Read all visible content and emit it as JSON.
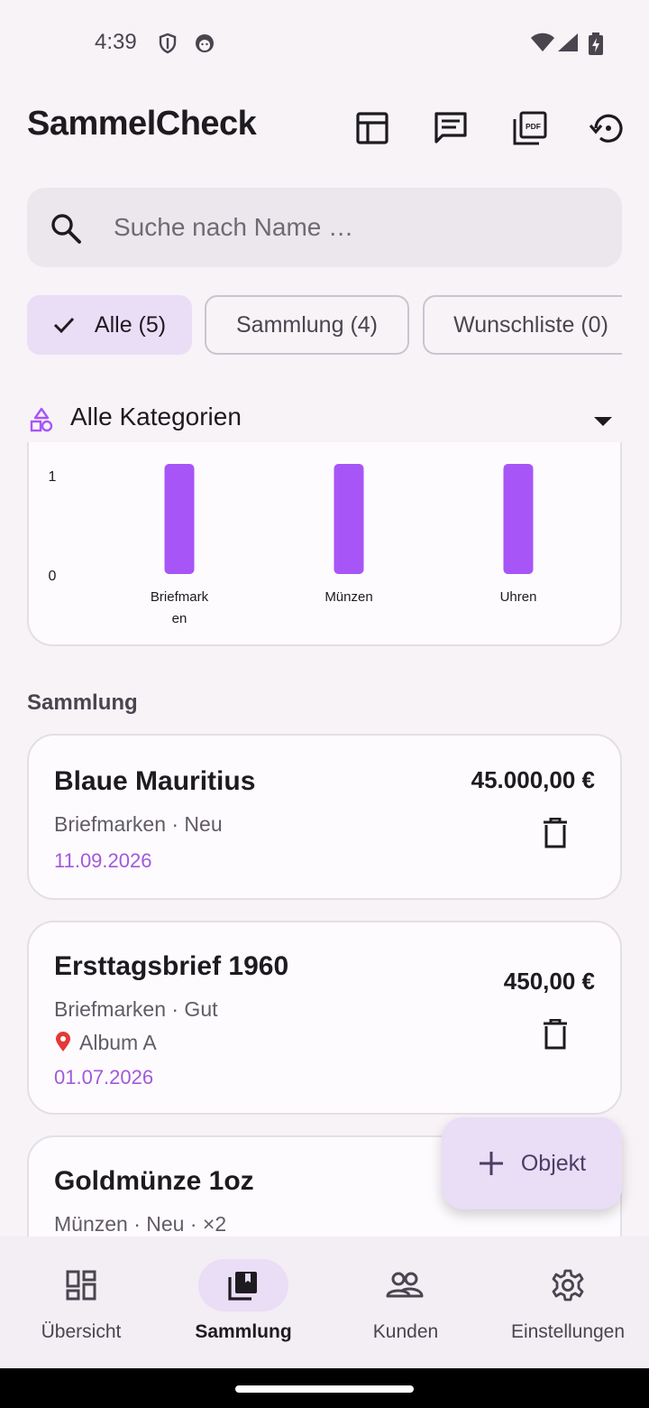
{
  "status_bar": {
    "time": "4:39",
    "icons": [
      "shield-icon",
      "face-icon",
      "wifi-icon",
      "signal-icon",
      "battery-charging-icon"
    ]
  },
  "app_bar": {
    "title": "SammelCheck",
    "actions": [
      "table-icon",
      "message-icon",
      "pdf-icon",
      "history-icon"
    ]
  },
  "search": {
    "placeholder": "Suche nach Name …",
    "value": ""
  },
  "filter_chips": [
    {
      "label": "Alle (5)",
      "selected": true
    },
    {
      "label": "Sammlung (4)",
      "selected": false
    },
    {
      "label": "Wunschliste (0)",
      "selected": false
    }
  ],
  "category_select": {
    "selected": "Alle Kategorien",
    "icon": "category-icon"
  },
  "chart_data": {
    "type": "bar",
    "categories": [
      "Briefmarken",
      "Münzen",
      "Uhren"
    ],
    "values": [
      1,
      1,
      1
    ],
    "visible_ticks": [
      "1",
      "0"
    ],
    "ylim": [
      0,
      1
    ],
    "color": "#a855f7"
  },
  "collection": {
    "heading": "Sammlung",
    "items": [
      {
        "name": "Blaue Mauritius",
        "subtitle": "Briefmarken · Neu",
        "location": "",
        "date": "11.09.2026",
        "price": "45.000,00 €"
      },
      {
        "name": "Ersttagsbrief 1960",
        "subtitle": "Briefmarken · Gut",
        "location": "Album A",
        "date": "01.07.2026",
        "price": "450,00 €"
      },
      {
        "name": "Goldmünze 1oz",
        "subtitle": "Münzen · Neu · ×2",
        "location": "",
        "date": "",
        "price": ""
      }
    ]
  },
  "fab": {
    "label": "Objekt",
    "icon": "plus-icon"
  },
  "bottom_nav": [
    {
      "label": "Übersicht",
      "icon": "dashboard-icon",
      "selected": false
    },
    {
      "label": "Sammlung",
      "icon": "collections-icon",
      "selected": true
    },
    {
      "label": "Kunden",
      "icon": "people-icon",
      "selected": false
    },
    {
      "label": "Einstellungen",
      "icon": "settings-icon",
      "selected": false
    }
  ],
  "colors": {
    "accent": "#a855f7",
    "chip_selected": "#eaddf6",
    "date": "#a259d9",
    "background": "#f7f3f7"
  }
}
